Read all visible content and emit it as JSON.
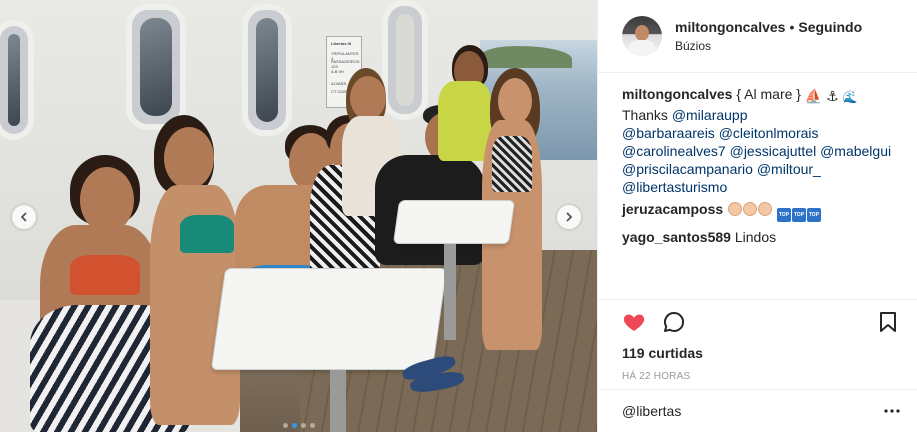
{
  "header": {
    "username": "miltongoncalves",
    "separator": "•",
    "follow_status": "Seguindo",
    "location": "Búzios"
  },
  "caption": {
    "username": "miltongoncalves",
    "text_start": "{ Al mare }",
    "emojis": [
      "⛵",
      "⚓",
      "🌊"
    ],
    "thanks": "Thanks",
    "mentions": [
      "@milaraupp",
      "@barbaraareis",
      "@cleitonlmorais",
      "@carolinealves7",
      "@jessicajuttel",
      "@mabelgui",
      "@priscilacampanario",
      "@miltour_",
      "@libertasturismo"
    ]
  },
  "comments": [
    {
      "username": "jeruzacamposs",
      "emojis": [
        "clap",
        "clap",
        "clap",
        "top",
        "top",
        "top"
      ],
      "text": ""
    },
    {
      "username": "yago_santos589",
      "emojis": [],
      "text": "Lindos"
    }
  ],
  "emoji_text": {
    "top": "TOP"
  },
  "stats": {
    "likes": "119 curtidas",
    "time": "HÁ 22 HORAS"
  },
  "add_comment": {
    "value": "@libertas"
  },
  "photo": {
    "sign_lines": [
      "Libertas III",
      "TRIPULANTES 4",
      "PASSAGEIROS 123",
      "A.B 9H",
      "ALVARÁ",
      "CT 22/2013"
    ]
  },
  "carousel": {
    "total": 4,
    "active_index": 1
  },
  "colors": {
    "heart": "#ed4956",
    "link": "#003569",
    "active_dot": "#3897f0",
    "text": "#262626",
    "muted": "#999999"
  }
}
